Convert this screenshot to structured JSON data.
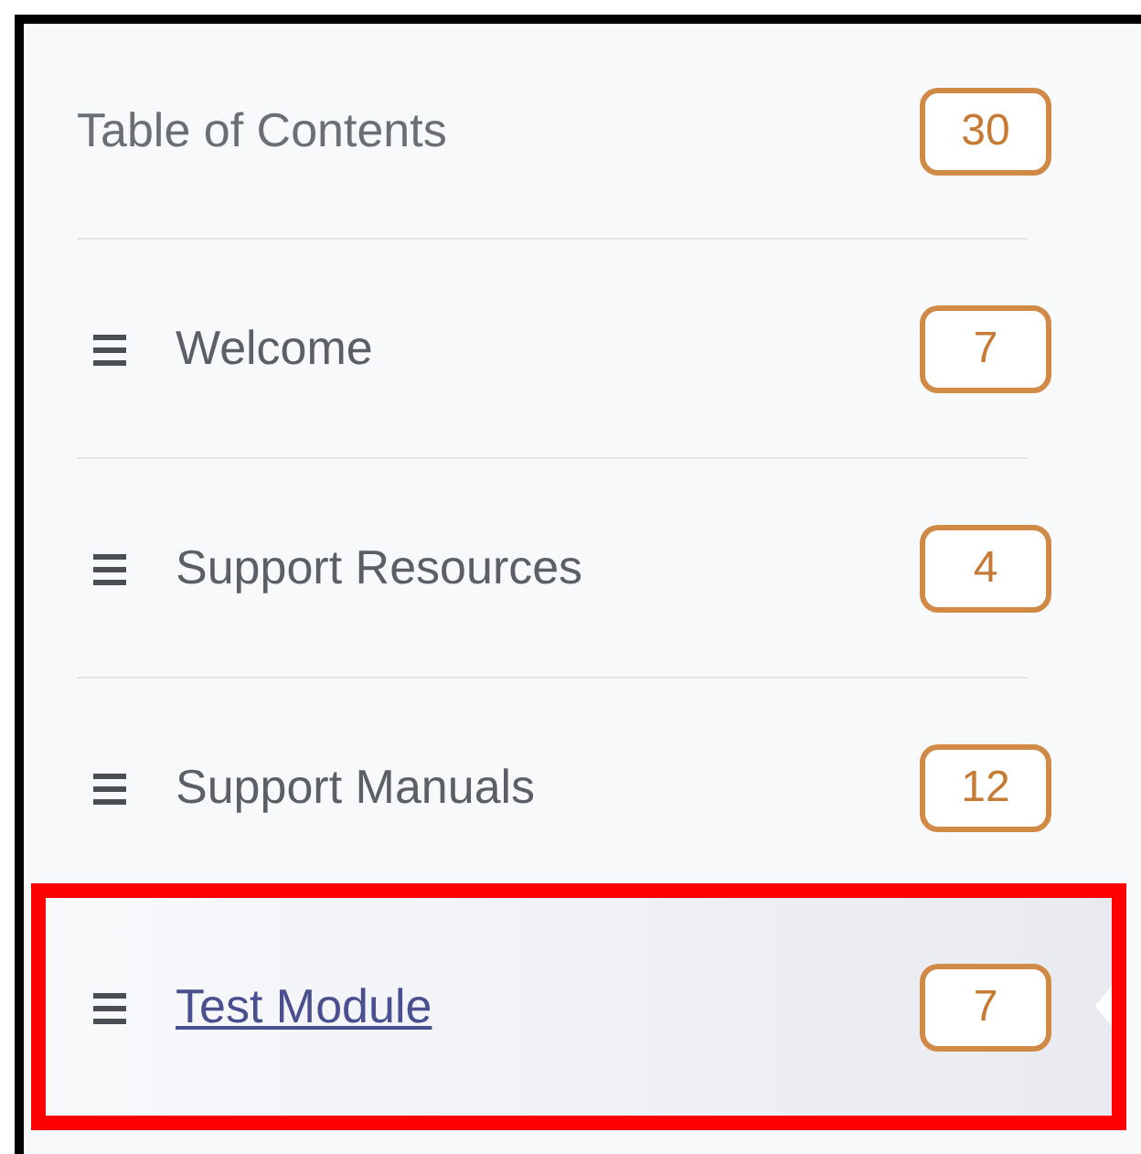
{
  "header": {
    "title": "Table of Contents",
    "count": "30"
  },
  "modules": [
    {
      "title": "Welcome",
      "count": "7",
      "selected": false
    },
    {
      "title": "Support Resources",
      "count": "4",
      "selected": false
    },
    {
      "title": "Support Manuals",
      "count": "12",
      "selected": false
    },
    {
      "title": "Test Module",
      "count": "7",
      "selected": true
    }
  ]
}
